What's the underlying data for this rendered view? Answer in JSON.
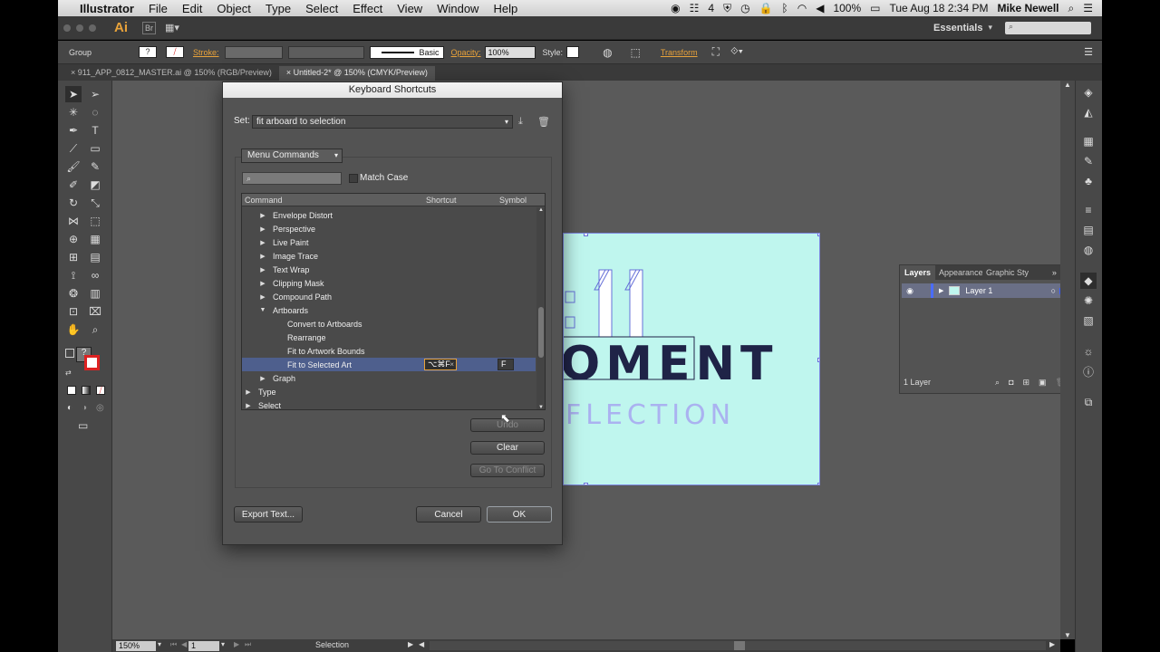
{
  "menubar": {
    "app": "Illustrator",
    "items": [
      "File",
      "Edit",
      "Object",
      "Type",
      "Select",
      "Effect",
      "View",
      "Window",
      "Help"
    ],
    "status": {
      "notif_count": "4",
      "battery": "100%",
      "datetime": "Tue Aug 18  2:34 PM",
      "user": "Mike Newell"
    }
  },
  "apptop": {
    "logo": "Ai",
    "bridge": "Br",
    "workspace": "Essentials"
  },
  "control": {
    "group": "Group",
    "stroke": "Stroke:",
    "brush": "Basic",
    "opacity_label": "Opacity:",
    "opacity": "100%",
    "style": "Style:",
    "transform": "Transform"
  },
  "tabs": [
    {
      "label": "911_APP_0812_MASTER.ai @ 150% (RGB/Preview)"
    },
    {
      "label": "Untitled-2* @ 150% (CMYK/Preview)"
    }
  ],
  "dialog": {
    "title": "Keyboard Shortcuts",
    "set_label": "Set:",
    "set_value": "fit arboard to selection",
    "category": "Menu Commands",
    "search_placeholder": "",
    "match_case": "Match Case",
    "columns": {
      "command": "Command",
      "shortcut": "Shortcut",
      "symbol": "Symbol"
    },
    "rows": [
      {
        "label": "Envelope Distort",
        "level": 1,
        "expander": "closed",
        "shortcut": "",
        "symbol": ""
      },
      {
        "label": "Perspective",
        "level": 1,
        "expander": "closed",
        "shortcut": "",
        "symbol": ""
      },
      {
        "label": "Live Paint",
        "level": 1,
        "expander": "closed",
        "shortcut": "",
        "symbol": ""
      },
      {
        "label": "Image Trace",
        "level": 1,
        "expander": "closed",
        "shortcut": "",
        "symbol": ""
      },
      {
        "label": "Text Wrap",
        "level": 1,
        "expander": "closed",
        "shortcut": "",
        "symbol": ""
      },
      {
        "label": "Clipping Mask",
        "level": 1,
        "expander": "closed",
        "shortcut": "",
        "symbol": ""
      },
      {
        "label": "Compound Path",
        "level": 1,
        "expander": "closed",
        "shortcut": "",
        "symbol": ""
      },
      {
        "label": "Artboards",
        "level": 1,
        "expander": "open",
        "shortcut": "",
        "symbol": ""
      },
      {
        "label": "Convert to Artboards",
        "level": 2,
        "expander": "",
        "shortcut": "",
        "symbol": ""
      },
      {
        "label": "Rearrange",
        "level": 2,
        "expander": "",
        "shortcut": "",
        "symbol": ""
      },
      {
        "label": "Fit to Artwork Bounds",
        "level": 2,
        "expander": "",
        "shortcut": "",
        "symbol": ""
      },
      {
        "label": "Fit to Selected Art",
        "level": 2,
        "expander": "",
        "shortcut": "⌥⌘F",
        "symbol": "F",
        "selected": true
      },
      {
        "label": "Graph",
        "level": 1,
        "expander": "closed",
        "shortcut": "",
        "symbol": ""
      },
      {
        "label": "Type",
        "level": 0,
        "expander": "closed",
        "shortcut": "",
        "symbol": ""
      },
      {
        "label": "Select",
        "level": 0,
        "expander": "closed",
        "shortcut": "",
        "symbol": ""
      }
    ],
    "buttons": {
      "undo": "Undo",
      "clear": "Clear",
      "go_to_conflict": "Go To Conflict",
      "export": "Export Text...",
      "cancel": "Cancel",
      "ok": "OK"
    }
  },
  "artwork": {
    "line1": "OMENT",
    "line2": "FLECTION"
  },
  "layers": {
    "tabs": [
      "Layers",
      "Appearance",
      "Graphic Sty"
    ],
    "layer_name": "Layer 1",
    "count": "1 Layer"
  },
  "status": {
    "zoom": "150%",
    "artboard": "1",
    "tool": "Selection"
  },
  "colors": {
    "artboard_bg": "#bff6ee",
    "selection": "#6670d8",
    "text_dark": "#1f2347"
  }
}
